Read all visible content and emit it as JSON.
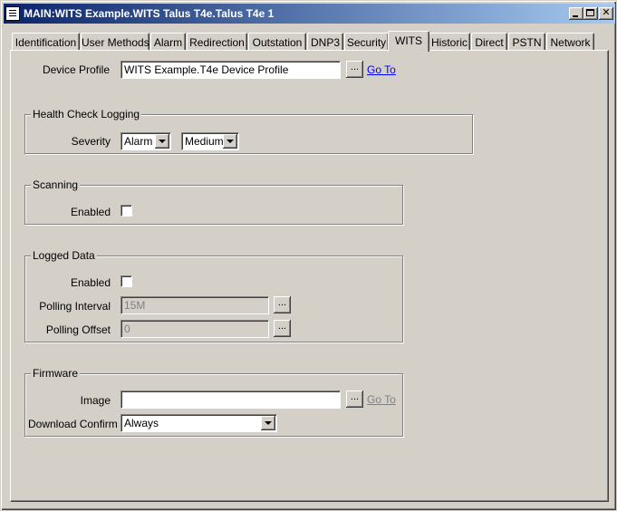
{
  "window": {
    "title": "MAIN:WITS Example.WITS Talus T4e.Talus T4e 1"
  },
  "tabs": [
    {
      "label": "Identification"
    },
    {
      "label": "User Methods"
    },
    {
      "label": "Alarm"
    },
    {
      "label": "Redirection"
    },
    {
      "label": "Outstation"
    },
    {
      "label": "DNP3"
    },
    {
      "label": "Security"
    },
    {
      "label": "WITS"
    },
    {
      "label": "Historic"
    },
    {
      "label": "Direct"
    },
    {
      "label": "PSTN"
    },
    {
      "label": "Network"
    }
  ],
  "active_tab": "WITS",
  "device_profile": {
    "label": "Device Profile",
    "value": "WITS Example.T4e Device Profile",
    "browse_label": "...",
    "goto_label": "Go To"
  },
  "health_check": {
    "title": "Health Check Logging",
    "severity_label": "Severity",
    "severity_value": "Alarm",
    "level_value": "Medium"
  },
  "scanning": {
    "title": "Scanning",
    "enabled_label": "Enabled",
    "enabled_checked": false
  },
  "logged_data": {
    "title": "Logged Data",
    "enabled_label": "Enabled",
    "enabled_checked": false,
    "polling_interval_label": "Polling Interval",
    "polling_interval_value": "15M",
    "polling_offset_label": "Polling Offset",
    "polling_offset_value": "0",
    "browse_label": "..."
  },
  "firmware": {
    "title": "Firmware",
    "image_label": "Image",
    "image_value": "",
    "browse_label": "...",
    "goto_label": "Go To",
    "download_confirm_label": "Download Confirm",
    "download_confirm_value": "Always"
  }
}
